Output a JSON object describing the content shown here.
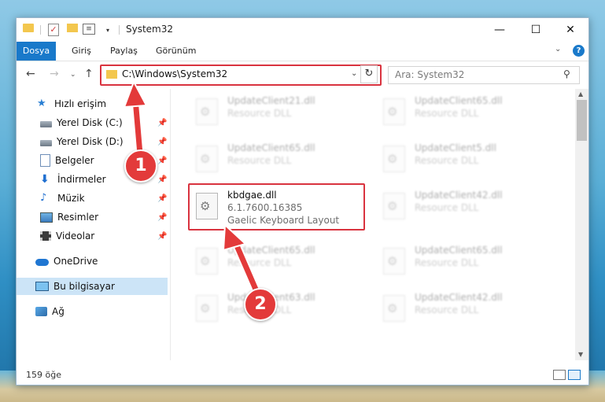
{
  "window": {
    "title": "System32",
    "controls": {
      "minimize": "—",
      "maximize": "☐",
      "close": "✕"
    }
  },
  "quick_access_toolbar": {
    "check_glyph": "✓",
    "props_glyph": "≡",
    "dropdown_glyph": "▾"
  },
  "ribbon": {
    "tabs": [
      {
        "label": "Dosya",
        "active": true
      },
      {
        "label": "Giriş"
      },
      {
        "label": "Paylaş"
      },
      {
        "label": "Görünüm"
      }
    ],
    "expand_glyph": "⌄",
    "help_glyph": "?"
  },
  "navigation": {
    "back_glyph": "←",
    "forward_glyph": "→",
    "recent_glyph": "⌄",
    "up_glyph": "↑",
    "address": "C:\\Windows\\System32",
    "address_dropdown_glyph": "⌄",
    "refresh_glyph": "↻",
    "search_placeholder": "Ara: System32",
    "search_glyph": "⚲"
  },
  "sidebar": {
    "pin_glyph": "📌",
    "items": [
      {
        "label": "Hızlı erişim",
        "icon": "star-icon",
        "glyph": "★"
      },
      {
        "label": "Yerel Disk (C:)",
        "icon": "drive-icon",
        "pinned": true
      },
      {
        "label": "Yerel Disk (D:)",
        "icon": "drive-icon",
        "pinned": true
      },
      {
        "label": "Belgeler",
        "icon": "document-icon",
        "pinned": true
      },
      {
        "label": "İndirmeler",
        "icon": "download-icon",
        "glyph": "⬇",
        "pinned": true
      },
      {
        "label": "Müzik",
        "icon": "music-icon",
        "glyph": "♪",
        "pinned": true
      },
      {
        "label": "Resimler",
        "icon": "pictures-icon",
        "pinned": true
      },
      {
        "label": "Videolar",
        "icon": "videos-icon",
        "pinned": true
      },
      {
        "label": "OneDrive",
        "icon": "cloud-icon"
      },
      {
        "label": "Bu bilgisayar",
        "icon": "computer-icon",
        "selected": true
      },
      {
        "label": "Ağ",
        "icon": "network-icon"
      }
    ]
  },
  "files": {
    "gear_glyph": "⚙",
    "left_column": [
      {
        "name": "UpdateClient21.dll",
        "type": "Resource DLL"
      },
      {
        "name": "UpdateClient65.dll",
        "type": "Resource DLL"
      },
      {
        "name": "kbdgae.dll",
        "version": "6.1.7600.16385",
        "description": "Gaelic Keyboard Layout",
        "highlighted": true
      },
      {
        "name": "UpdateClient65.dll",
        "type": "Resource DLL"
      },
      {
        "name": "UpdateClient63.dll",
        "type": "Resource DLL"
      }
    ],
    "right_column": [
      {
        "name": "UpdateClient65.dll",
        "type": "Resource DLL"
      },
      {
        "name": "UpdateClient5.dll",
        "type": "Resource DLL"
      },
      {
        "name": "UpdateClient42.dll",
        "type": "Resource DLL"
      },
      {
        "name": "UpdateClient65.dll",
        "type": "Resource DLL"
      },
      {
        "name": "UpdateClient42.dll",
        "type": "Resource DLL"
      }
    ]
  },
  "scrollbar": {
    "up_glyph": "▲",
    "down_glyph": "▼"
  },
  "status_bar": {
    "item_count": "159 öğe"
  },
  "annotations": {
    "step1_label": "1",
    "step2_label": "2",
    "color": "#e33a3a"
  },
  "colors": {
    "accent": "#1979ca",
    "highlight_border": "#d9333f",
    "selection": "#cce4f7"
  }
}
